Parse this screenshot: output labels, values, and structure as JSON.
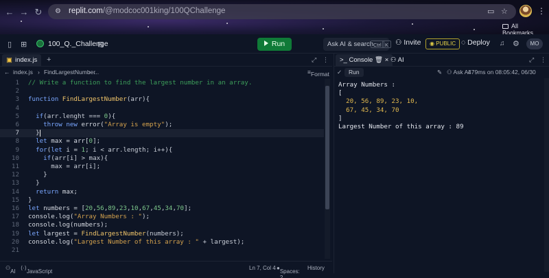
{
  "browser": {
    "url_host": "replit.com",
    "url_path": "/@modcoc001king/100QChallenge",
    "bookmarks_label": "All Bookmarks"
  },
  "topbar": {
    "repl_name": "100_Q._Challenge",
    "run_label": "Run",
    "search_label": "Ask AI & search",
    "search_kbd_1": "Ctrl",
    "search_kbd_2": "K",
    "invite_label": "Invite",
    "public_label": "PUBLIC",
    "deploy_label": "Deploy",
    "avatar_initials": "MO"
  },
  "editor": {
    "tab_name": "index.js",
    "breadcrumb": {
      "file": "index.js",
      "symbol": "FindLargestNumber",
      "more": "..."
    },
    "format_label": "Format",
    "active_line": 7,
    "lines": [
      [
        [
          "cm",
          "// Write a function to find the largest number in an array."
        ]
      ],
      [],
      [
        [
          "kw",
          "function "
        ],
        [
          "fn",
          "FindLargestNumber"
        ],
        [
          "op",
          "(arr){"
        ]
      ],
      [],
      [
        [
          "op",
          "  "
        ],
        [
          "kw",
          "if"
        ],
        [
          "op",
          "(arr.lenght === "
        ],
        [
          "num",
          "0"
        ],
        [
          "op",
          "){"
        ]
      ],
      [
        [
          "op",
          "    "
        ],
        [
          "kw",
          "throw new "
        ],
        [
          "id",
          "error("
        ],
        [
          "str",
          "\"Array is empty\""
        ],
        [
          "op",
          ");"
        ]
      ],
      [
        [
          "op",
          "  }"
        ]
      ],
      [
        [
          "op",
          "  "
        ],
        [
          "kw",
          "let "
        ],
        [
          "id",
          "max = arr["
        ],
        [
          "num",
          "0"
        ],
        [
          "op",
          "];"
        ]
      ],
      [
        [
          "op",
          "  "
        ],
        [
          "kw",
          "for"
        ],
        [
          "op",
          "("
        ],
        [
          "kw",
          "let "
        ],
        [
          "id",
          "i = "
        ],
        [
          "num",
          "1"
        ],
        [
          "op",
          "; i < arr.length; i++){"
        ]
      ],
      [
        [
          "op",
          "    "
        ],
        [
          "kw",
          "if"
        ],
        [
          "op",
          "(arr[i] > max){"
        ]
      ],
      [
        [
          "op",
          "      max = arr[i];"
        ]
      ],
      [
        [
          "op",
          "    }"
        ]
      ],
      [
        [
          "op",
          "  }"
        ]
      ],
      [
        [
          "op",
          "  "
        ],
        [
          "kw",
          "return "
        ],
        [
          "id",
          "max;"
        ]
      ],
      [
        [
          "op",
          "}"
        ]
      ],
      [
        [
          "kw",
          "let "
        ],
        [
          "id",
          "numbers = ["
        ],
        [
          "num",
          "20"
        ],
        [
          "op",
          ","
        ],
        [
          "num",
          "56"
        ],
        [
          "op",
          ","
        ],
        [
          "num",
          "89"
        ],
        [
          "op",
          ","
        ],
        [
          "num",
          "23"
        ],
        [
          "op",
          ","
        ],
        [
          "num",
          "10"
        ],
        [
          "op",
          ","
        ],
        [
          "num",
          "67"
        ],
        [
          "op",
          ","
        ],
        [
          "num",
          "45"
        ],
        [
          "op",
          ","
        ],
        [
          "num",
          "34"
        ],
        [
          "op",
          ","
        ],
        [
          "num",
          "70"
        ],
        [
          "op",
          "];"
        ]
      ],
      [
        [
          "id",
          "console.log("
        ],
        [
          "str",
          "\"Array Numbers : \""
        ],
        [
          "op",
          ");"
        ]
      ],
      [
        [
          "id",
          "console.log(numbers);"
        ]
      ],
      [
        [
          "kw",
          "let "
        ],
        [
          "id",
          "largest = "
        ],
        [
          "fn",
          "FindLargestNumber"
        ],
        [
          "op",
          "(numbers);"
        ]
      ],
      [
        [
          "id",
          "console.log("
        ],
        [
          "str",
          "\"Largest Number of this array : \""
        ],
        [
          "op",
          " + largest);"
        ]
      ],
      []
    ],
    "status": {
      "ai": "AI",
      "language": "JavaScript",
      "position": "Ln 7, Col 4",
      "spaces": "Spaces: 2",
      "history": "History"
    }
  },
  "console": {
    "tab_console": "Console",
    "tab_ai": "AI",
    "run_label": "Run",
    "ask_ai": "Ask AI",
    "timing": "479ms on 08:05:42, 06/30",
    "output": {
      "l1": "Array Numbers :",
      "l2": "[",
      "l3": "  20, 56, 89, 23, 10,",
      "l4": "  67, 45, 34, 70",
      "l5": "]",
      "l6": "Largest Number of this array : 89"
    }
  }
}
